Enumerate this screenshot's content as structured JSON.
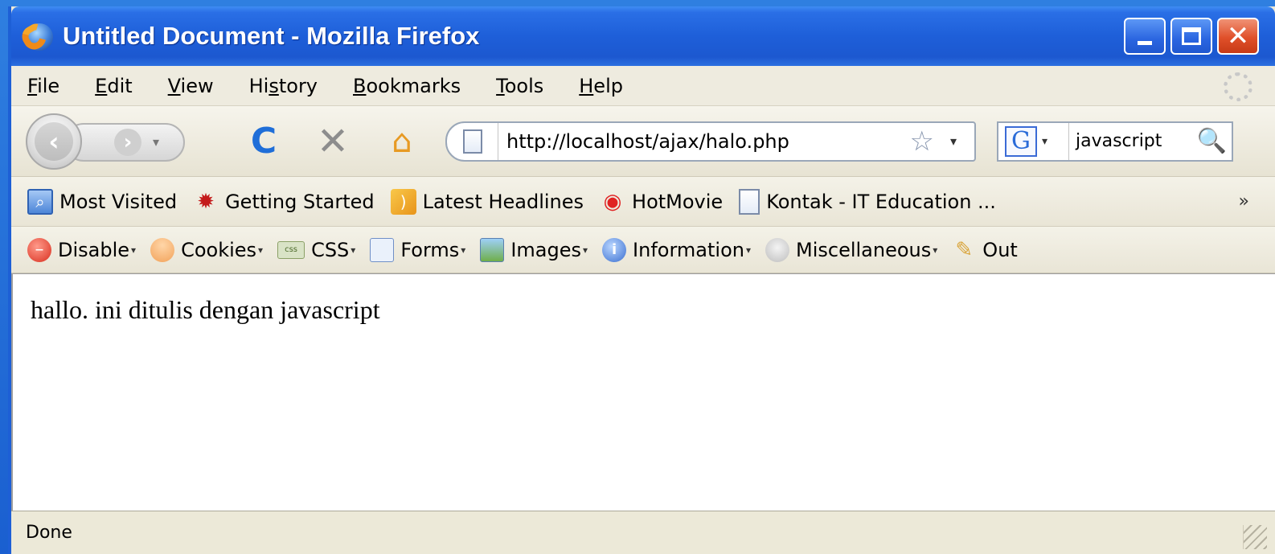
{
  "window": {
    "title": "Untitled Document - Mozilla Firefox",
    "minimize_icon": "minimize-icon",
    "maximize_icon": "maximize-icon",
    "close_icon": "close-icon",
    "close_glyph": "✕"
  },
  "menu": {
    "items": [
      {
        "label": "File",
        "u": "F",
        "rest": "ile"
      },
      {
        "label": "Edit",
        "u": "E",
        "rest": "dit"
      },
      {
        "label": "View",
        "u": "V",
        "rest": "iew"
      },
      {
        "label": "History",
        "pre": "Hi",
        "u": "s",
        "rest": "tory"
      },
      {
        "label": "Bookmarks",
        "u": "B",
        "rest": "ookmarks"
      },
      {
        "label": "Tools",
        "u": "T",
        "rest": "ools"
      },
      {
        "label": "Help",
        "u": "H",
        "rest": "elp"
      }
    ]
  },
  "nav": {
    "back_glyph": "‹",
    "forward_glyph": "›",
    "dropdown_glyph": "▾",
    "reload_glyph": "C",
    "stop_glyph": "✕",
    "home_glyph": "⌂",
    "url": "http://localhost/ajax/halo.php",
    "star_glyph": "☆",
    "url_dropdown_glyph": "▾",
    "search_engine_letter": "G",
    "search_value": "javascript",
    "search_glyph": "🔍"
  },
  "bookmarks": {
    "items": [
      "Most Visited",
      "Getting Started",
      "Latest Headlines",
      "HotMovie",
      "Kontak - IT Education ..."
    ],
    "overflow_glyph": "»"
  },
  "devtools": {
    "items": [
      "Disable",
      "Cookies",
      "CSS",
      "Forms",
      "Images",
      "Information",
      "Miscellaneous",
      "Out"
    ],
    "css_icon_text": "css",
    "info_glyph": "i",
    "disable_glyph": "–",
    "arrow_glyph": "▾"
  },
  "page": {
    "content": "hallo. ini ditulis dengan javascript"
  },
  "status": {
    "text": "Done"
  },
  "colors": {
    "titlebar": "#1e5fd9",
    "desktop": "#2f7fe0",
    "chrome": "#ece9d8"
  }
}
